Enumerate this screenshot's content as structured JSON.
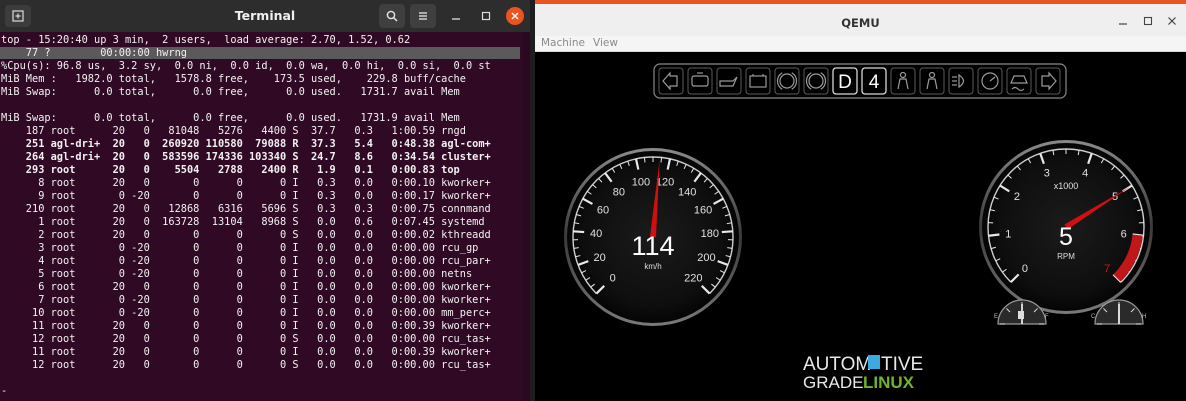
{
  "terminal": {
    "title": "Terminal",
    "lines": [
      "top - 15:20:40 up 3 min,  2 users,  load average: 2.70, 1.52, 0.62",
      "    77 ?        00:00:00 hwrng",
      "%Cpu(s): 96.8 us,  3.2 sy,  0.0 ni,  0.0 id,  0.0 wa,  0.0 hi,  0.0 si,  0.0 st",
      "MiB Mem :   1982.0 total,   1578.8 free,    173.5 used,    229.8 buff/cache",
      "MiB Swap:      0.0 total,      0.0 free,      0.0 used.   1731.7 avail Mem",
      "",
      "MiB Swap:      0.0 total,      0.0 free,      0.0 used.   1731.9 avail Mem",
      "    187 root      20   0   81048   5276   4400 S  37.7   0.3   1:00.59 rngd",
      "    251 agl-dri+  20   0  260920 110580  79088 R  37.3   5.4   0:48.38 agl-com+",
      "    264 agl-dri+  20   0  583596 174336 103340 S  24.7   8.6   0:34.54 cluster+",
      "    293 root      20   0    5504   2788   2400 R   1.9   0.1   0:00.83 top",
      "      8 root      20   0       0      0      0 I   0.3   0.0   0:00.10 kworker+",
      "      9 root       0 -20       0      0      0 I   0.3   0.0   0:00.17 kworker+",
      "    210 root      20   0   12868   6316   5696 S   0.3   0.3   0:00.75 connmand",
      "      1 root      20   0  163728  13104   8968 S   0.0   0.6   0:07.45 systemd",
      "      2 root      20   0       0      0      0 S   0.0   0.0   0:00.02 kthreadd",
      "      3 root       0 -20       0      0      0 I   0.0   0.0   0:00.00 rcu_gp",
      "      4 root       0 -20       0      0      0 I   0.0   0.0   0:00.00 rcu_par+",
      "      5 root       0 -20       0      0      0 I   0.0   0.0   0:00.00 netns",
      "      6 root      20   0       0      0      0 I   0.0   0.0   0:00.00 kworker+",
      "      7 root       0 -20       0      0      0 I   0.0   0.0   0:00.00 kworker+",
      "     10 root       0 -20       0      0      0 I   0.0   0.0   0:00.00 mm_perc+",
      "     11 root      20   0       0      0      0 I   0.0   0.0   0:00.39 kworker+",
      "     12 root      20   0       0      0      0 S   0.0   0.0   0:00.00 rcu_tas+",
      "     11 root      20   0       0      0      0 I   0.0   0.0   0:00.39 kworker+",
      "     12 root      20   0       0      0      0 S   0.0   0.0   0:00.00 rcu_tas+",
      "",
      "-"
    ],
    "bold_lines": [
      8,
      9,
      10
    ],
    "highlight_line": 1,
    "colors": {
      "background": "#300a24",
      "text": "#f2f2f2",
      "highlight": "#5a5a5a"
    }
  },
  "qemu": {
    "title": "QEMU",
    "menu": [
      "Machine",
      "View"
    ],
    "indicator_icons": [
      "turn-left-icon",
      "engine-icon",
      "oil-icon",
      "battery-icon",
      "abs-icon",
      "brake-icon",
      "gear-d",
      "gear-4",
      "seatbelt-icon",
      "airbag-icon",
      "headlight-icon",
      "cruise-icon",
      "traction-icon",
      "turn-right-icon"
    ],
    "gear_letter": "D",
    "gear_number": "4",
    "speedometer": {
      "value": 114,
      "value_text": "114",
      "unit": "km/h",
      "min": 0,
      "max": 220,
      "ticks": [
        "0",
        "20",
        "40",
        "60",
        "80",
        "100",
        "120",
        "140",
        "160",
        "180",
        "200",
        "220"
      ]
    },
    "tachometer": {
      "value": 5,
      "value_text": "5",
      "unit": "RPM",
      "multiplier": "x1000",
      "min": 0,
      "max": 7,
      "ticks": [
        "0",
        "1",
        "2",
        "3",
        "4",
        "5",
        "6",
        "7"
      ],
      "redline_from": 6
    },
    "fuel_gauge": {
      "labels": [
        "E",
        "F"
      ],
      "level": 0.5
    },
    "temp_gauge": {
      "labels": [
        "C",
        "H"
      ],
      "level": 0.5
    },
    "logo": {
      "line1_a": "AUTOM",
      "line1_b": "TIVE",
      "line2_a": "GRADE",
      "line2_b": "LINUX"
    },
    "colors": {
      "needle": "#d01010",
      "accent_blue": "#3da9e0",
      "logo_green": "#6fb52c",
      "window_accent": "#e95420"
    }
  }
}
